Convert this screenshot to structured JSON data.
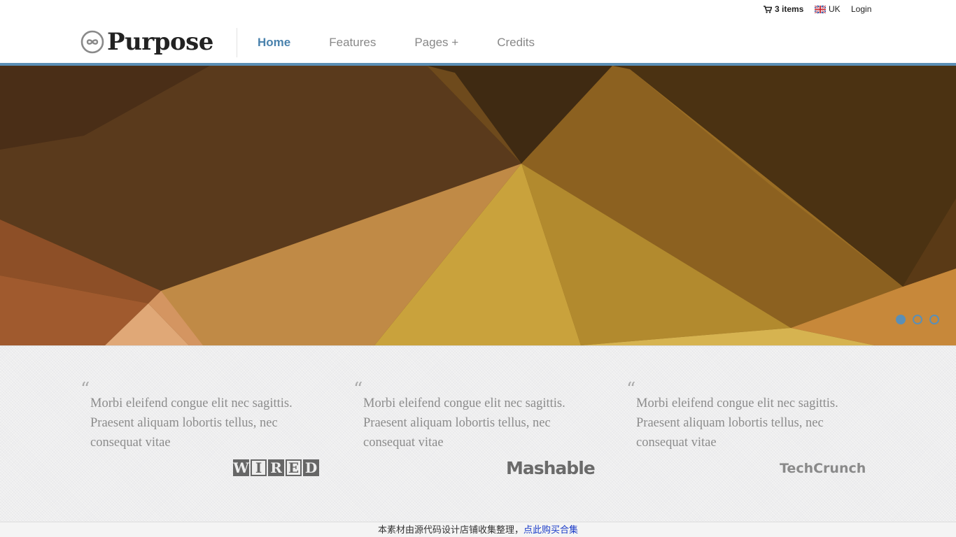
{
  "utility": {
    "cart_label": "3 items",
    "lang_label": "UK",
    "login_label": "Login"
  },
  "logo": {
    "text": "Purpose"
  },
  "nav": [
    {
      "label": "Home",
      "active": true
    },
    {
      "label": "Features"
    },
    {
      "label": "Pages +"
    },
    {
      "label": "Credits"
    }
  ],
  "slider": {
    "slides": 3,
    "active_slide": 1
  },
  "testimonials": [
    {
      "text": "Morbi eleifend congue elit nec sagittis. Praesent aliquam lobortis tellus, nec consequat vitae",
      "brand": "WIRED"
    },
    {
      "text": "Morbi eleifend congue elit nec sagittis. Praesent aliquam lobortis tellus, nec consequat vitae",
      "brand": "Mashable"
    },
    {
      "text": "Morbi eleifend congue elit nec sagittis. Praesent aliquam lobortis tellus, nec consequat vitae",
      "brand": "TechCrunch"
    }
  ],
  "quote_mark": "“",
  "footer": {
    "text": "本素材由源代码设计店铺收集整理，",
    "link": "点此购买合集"
  },
  "colors": {
    "accent": "#5b8fb6",
    "nav_active": "#4a82ad",
    "footer_link": "#1a3bc8"
  },
  "icons": [
    "cart-icon",
    "uk-flag-icon",
    "infinity-logo-icon",
    "quote-icon"
  ]
}
